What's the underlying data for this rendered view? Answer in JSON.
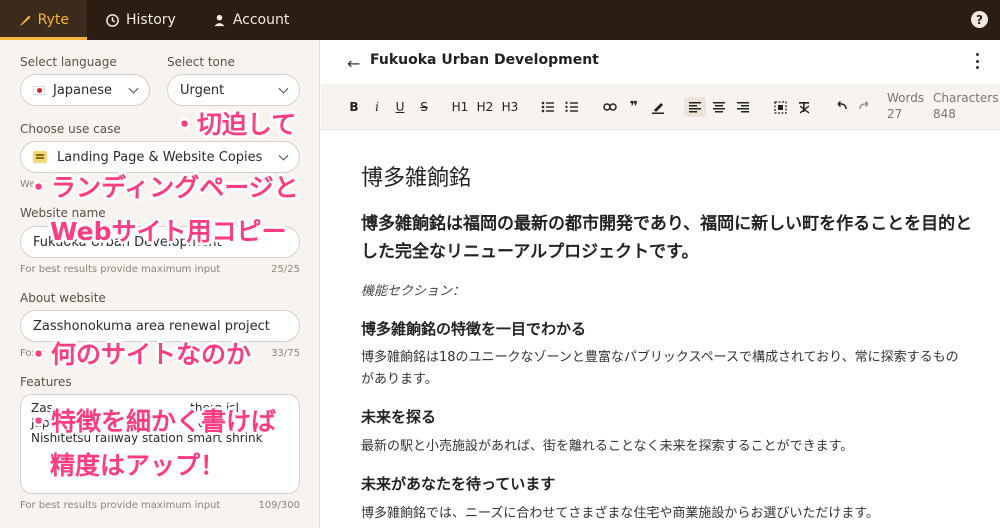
{
  "nav": {
    "tabs": [
      {
        "label": "Ryte",
        "icon": "feather-icon",
        "active": true
      },
      {
        "label": "History",
        "icon": "history-icon"
      },
      {
        "label": "Account",
        "icon": "user-icon"
      }
    ],
    "help_label": "?"
  },
  "sidebar": {
    "language_label": "Select language",
    "language_value": "Japanese",
    "tone_label": "Select tone",
    "tone_value": "Urgent",
    "use_case_label": "Choose use case",
    "use_case_value": "Landing Page & Website Copies",
    "use_case_hint": "We s",
    "website_name_label": "Website name",
    "website_name_value": "Fukuoka Urban Development",
    "website_name_hint": "For best results provide maximum input",
    "website_name_count": "25/25",
    "about_label": "About website",
    "about_value": "Zasshonokuma area renewal project",
    "about_hint": "For b",
    "about_count": "33/75",
    "features_label": "Features",
    "features_value": "Zas                                    thern isl\nJapa                                     ent\nNishitetsu railway station smart shrink",
    "features_hint": "For best results provide maximum input",
    "features_count": "109/300"
  },
  "annotations": {
    "a1": "・切迫して",
    "a2": "・ランディングページと",
    "a3": "Webサイト用コピー",
    "a4": "・何のサイトなのか",
    "a5": "・特徴を細かく書けば",
    "a6": "精度はアップ！"
  },
  "editor": {
    "title": "Fukuoka Urban Development",
    "toolbar": {
      "bold": "B",
      "italic": "i",
      "underline": "U",
      "strike": "S",
      "h1": "H1",
      "h2": "H2",
      "h3": "H3",
      "quote": "❞"
    },
    "words_label": "Words",
    "words_value": "27",
    "characters_label": "Characters",
    "characters_value": "848"
  },
  "document": {
    "heading": "博多雑餉銘",
    "lead": "博多雑餉銘は福岡の最新の都市開発であり、福岡に新しい町を作ることを目的とした完全なリニューアルプロジェクトです。",
    "section_label": "機能セクション：",
    "s1_title": "博多雑餉銘の特徴を一目でわかる",
    "s1_body": "博多雑餉銘は18のユニークなゾーンと豊富なパブリックスペースで構成されており、常に探索するものがあります。",
    "s2_title": "未来を探る",
    "s2_body": "最新の駅と小売施設があれば、街を離れることなく未来を探索することができます。",
    "s3_title": "未来があなたを待っています",
    "s3_body": "博多雑餉銘では、ニーズに合わせてさまざまな住宅や商業施設からお選びいただけます。"
  },
  "colors": {
    "topbar": "#2b1d12",
    "accent": "#f4b43a",
    "annotation": "#ff3d7f"
  }
}
